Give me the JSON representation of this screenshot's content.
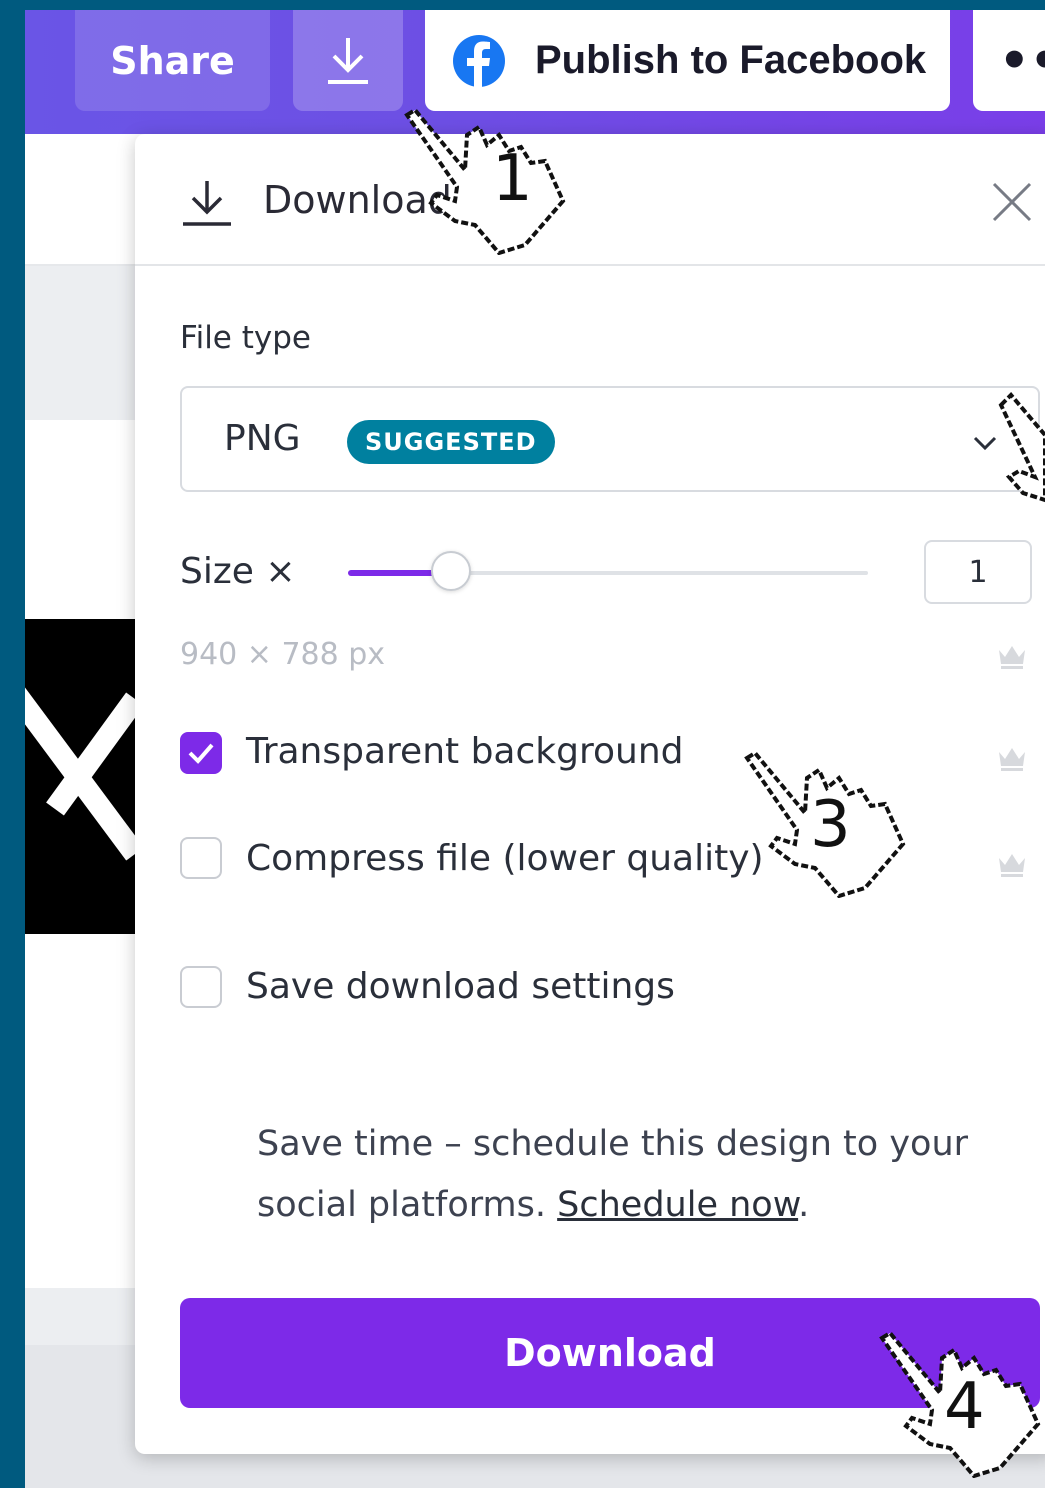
{
  "toolbar": {
    "share_label": "Share",
    "download_icon": "download-icon",
    "publish_label": "Publish to Facebook",
    "publish_icon": "facebook-icon",
    "more_label": "•••"
  },
  "panel": {
    "title": "Download",
    "file_type_label": "File type",
    "file_type_value": "PNG",
    "file_type_badge": "SUGGESTED",
    "size_label": "Size ×",
    "size_value": "1",
    "size_scale_fraction": 0.2,
    "dimensions": "940 × 788 px",
    "options": [
      {
        "label": "Transparent background",
        "checked": true,
        "premium": true
      },
      {
        "label": "Compress file (lower quality)",
        "checked": false,
        "premium": true
      },
      {
        "label": "Save download settings",
        "checked": false,
        "premium": false
      }
    ],
    "promo_text": "Save time – schedule this design to your social platforms.",
    "promo_link": "Schedule now",
    "promo_end": ".",
    "download_button": "Download"
  },
  "annotations": {
    "step1": "1",
    "step3": "3",
    "step4": "4"
  },
  "colors": {
    "frame": "#005a7f",
    "toolbar": "#6d4fe4",
    "accent_purple": "#7d2ae8",
    "badge_teal": "#00809f"
  }
}
